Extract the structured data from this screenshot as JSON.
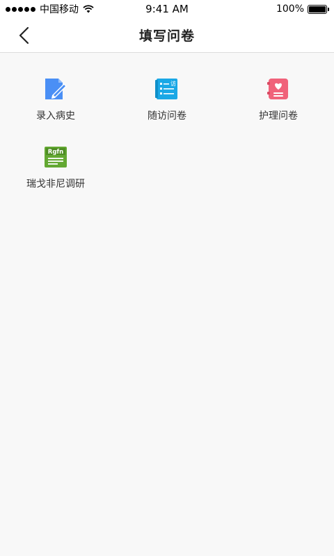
{
  "status": {
    "carrier": "中国移动",
    "time": "9:41 AM",
    "battery": "100%"
  },
  "nav": {
    "title": "填写问卷"
  },
  "menu": [
    {
      "label": "录入病史",
      "icon": "document-edit-icon",
      "color": "#4a8ff5"
    },
    {
      "label": "随访问卷",
      "icon": "list-visit-icon",
      "color": "#1aa8e6"
    },
    {
      "label": "护理问卷",
      "icon": "heart-list-icon",
      "color": "#f0627a"
    },
    {
      "label": "瑞戈非尼调研",
      "icon": "rgfn-document-icon",
      "color": "#63a832",
      "icon_text": "Rgfn"
    }
  ],
  "icons": {
    "visit_char": "访"
  }
}
